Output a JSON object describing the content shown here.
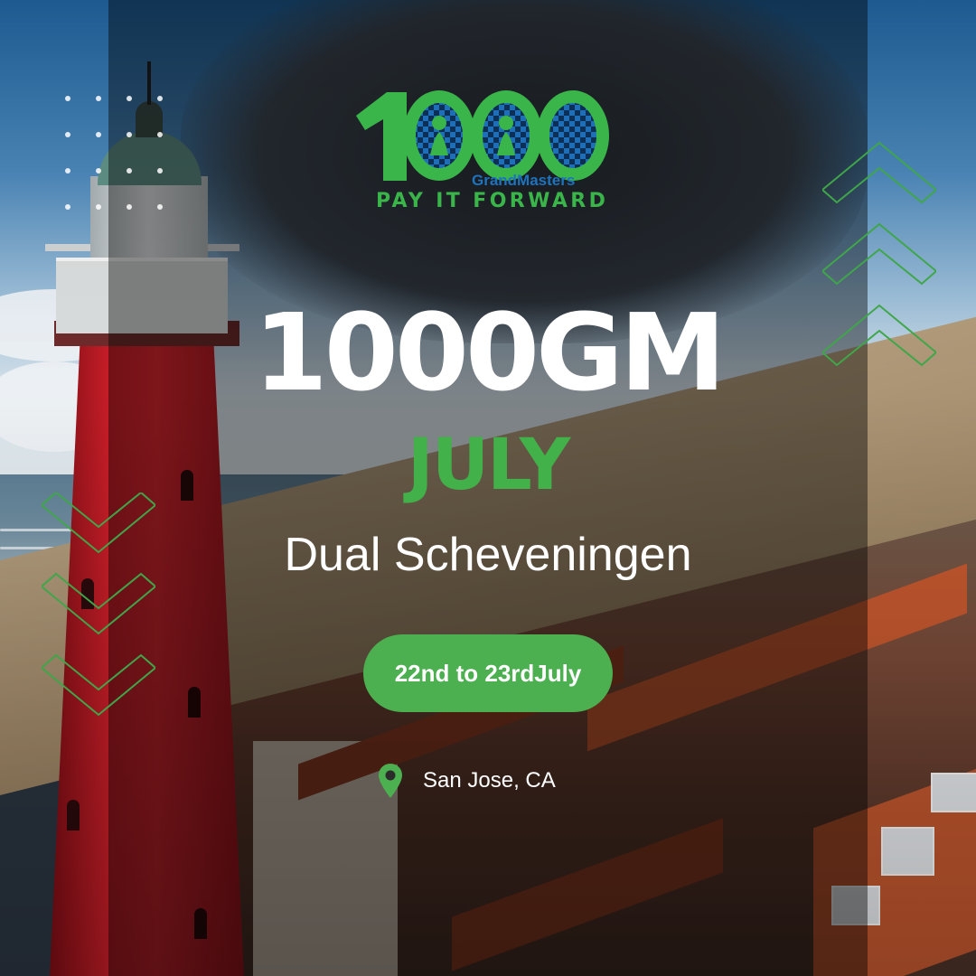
{
  "logo": {
    "number": "1000",
    "brand": "GrandMasters",
    "tagline": "PAY IT FORWARD",
    "green": "#39b54a",
    "blue": "#1e73be"
  },
  "headline": "1000GM",
  "month": "JULY",
  "event_name": "Dual Scheveningen",
  "dates": "22nd to 23rdJuly",
  "location": {
    "icon": "map-pin-icon",
    "label": "San Jose, CA"
  },
  "colors": {
    "accent": "#4caf50",
    "month_text": "#42b14a",
    "text": "#ffffff"
  }
}
